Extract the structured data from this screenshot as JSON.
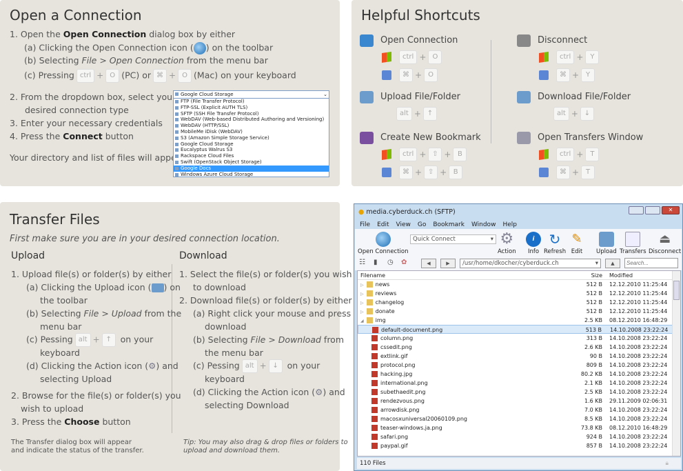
{
  "open_connection": {
    "title": "Open a Connection",
    "step1": "1.  Open the",
    "step1_bold": "Open Connection",
    "step1_rest": "dialog box by either",
    "step1a": "(a) Clicking the Open Connection icon (",
    "step1a_rest": ") on the toolbar",
    "step1b_pre": "(b) Selecting",
    "step1b_em": "File > Open Connection",
    "step1b_rest": "from the menu bar",
    "step1c_pre": "(c) Pressing",
    "key_ctrl": "ctrl",
    "key_o": "O",
    "pc": "(PC) or",
    "key_cmd": "⌘",
    "mac": "(Mac) on your keyboard",
    "plus": "+",
    "step2a": "2.  From the dropdown box, select your",
    "step2b": "desired connection type",
    "step3": "3.  Enter your necessary credentials",
    "step4": "4.  Press the",
    "step4_bold": "Connect",
    "step4_rest": "button",
    "footer": "Your directory and list of files will appear.",
    "dropdown": {
      "selected": "Google Cloud Storage",
      "highlighted": "Google Docs",
      "options": [
        "FTP (File Transfer Protocol)",
        "FTP-SSL (Explicit AUTH TLS)",
        "SFTP (SSH File Transfer Protocol)",
        "WebDAV (Web-based Distributed Authoring and Versioning)",
        "WebDAV (HTTP/SSL)",
        "MobileMe iDisk (WebDAV)",
        "S3 (Amazon Simple Storage Service)",
        "Google Cloud Storage",
        "Eucalyptus Walrus S3",
        "Rackspace Cloud Files",
        "Swift (OpenStack Object Storage)",
        "Google Docs",
        "Windows Azure Cloud Storage"
      ]
    }
  },
  "shortcuts": {
    "title": "Helpful Shortcuts",
    "plus": "+",
    "items": [
      {
        "label": "Open Connection",
        "win": [
          "ctrl",
          "O"
        ],
        "mac": [
          "⌘",
          "O"
        ]
      },
      {
        "label": "Upload File/Folder",
        "all": [
          "alt",
          "↑"
        ]
      },
      {
        "label": "Create New Bookmark",
        "win": [
          "ctrl",
          "⇧",
          "B"
        ],
        "mac": [
          "⌘",
          "⇧",
          "B"
        ]
      },
      {
        "label": "Disconnect",
        "win": [
          "ctrl",
          "Y"
        ],
        "mac": [
          "⌘",
          "Y"
        ]
      },
      {
        "label": "Download File/Folder",
        "all": [
          "alt",
          "↓"
        ]
      },
      {
        "label": "Open Transfers Window",
        "win": [
          "ctrl",
          "T"
        ],
        "mac": [
          "⌘",
          "T"
        ]
      }
    ]
  },
  "transfer": {
    "title": "Transfer Files",
    "subtitle": "First make sure you are in your desired connection location.",
    "upload": {
      "heading": "Upload",
      "l1": "1.  Upload file(s) or folder(s) by either",
      "l2": "(a) Clicking the Upload icon (",
      "l2b": ") on",
      "l3": "the toolbar",
      "l4": "(b) Selecting",
      "l4em": "File > Upload",
      "l4b": "from the",
      "l5": "menu bar",
      "l6": "(c) Pessing",
      "k1": "alt",
      "k2": "↑",
      "l6b": "on your",
      "l7": "keyboard",
      "l8": "(d) Clicking the Action icon (",
      "l8b": ") and",
      "l9": "selecting Upload",
      "l10": "2.  Browse for the file(s) or folder(s) you",
      "l11": "wish to upload",
      "l12": "3.  Press the",
      "l12b": "Choose",
      "l12c": "button",
      "f1": "The Transfer dialog box will appear",
      "f2": "and indicate the status of the transfer."
    },
    "download": {
      "heading": "Download",
      "l1": "1.  Select the file(s) or folder(s) you wish",
      "l2": "to download",
      "l3": "2.  Download file(s) or folder(s) by either",
      "l4": "(a) Right click your mouse and press",
      "l5": "download",
      "l6": "(b) Selecting",
      "l6em": "File > Download",
      "l6b": "from",
      "l7": "the menu bar",
      "l8": "(c) Pessing",
      "k1": "alt",
      "k2": "↓",
      "l8b": "on your",
      "l9": "keyboard",
      "l10": "(d) Clicking the Action icon (",
      "l10b": ") and",
      "l11": "selecting Download",
      "tip1": "Tip: You may also drag & drop files or folders to",
      "tip2": "upload and download them."
    }
  },
  "window": {
    "title": "media.cyberduck.ch (SFTP)",
    "menu": [
      "File",
      "Edit",
      "View",
      "Go",
      "Bookmark",
      "Window",
      "Help"
    ],
    "toolbar": {
      "open": "Open Connection",
      "quick": "Quick Connect",
      "action": "Action",
      "info": "Info",
      "refresh": "Refresh",
      "edit": "Edit",
      "upload": "Upload",
      "transfers": "Transfers",
      "disconnect": "Disconnect"
    },
    "path": "/usr/home/dkocher/cyberduck.ch",
    "search_placeholder": "Search...",
    "columns": [
      "Filename",
      "Size",
      "Modified"
    ],
    "files": [
      {
        "name": "news",
        "size": "512 B",
        "mod": "12.12.2010 11:25:44",
        "type": "folder"
      },
      {
        "name": "reviews",
        "size": "512 B",
        "mod": "12.12.2010 11:25:44",
        "type": "folder"
      },
      {
        "name": "changelog",
        "size": "512 B",
        "mod": "12.12.2010 11:25:44",
        "type": "folder"
      },
      {
        "name": "donate",
        "size": "512 B",
        "mod": "12.12.2010 11:25:44",
        "type": "folder"
      },
      {
        "name": "img",
        "size": "2.5 KB",
        "mod": "08.12.2010 16:48:29",
        "type": "folder-open"
      },
      {
        "name": "default-document.png",
        "size": "513 B",
        "mod": "14.10.2008 23:22:24",
        "type": "file",
        "selected": true
      },
      {
        "name": "column.png",
        "size": "313 B",
        "mod": "14.10.2008 23:22:24",
        "type": "file"
      },
      {
        "name": "cssedit.png",
        "size": "2.6 KB",
        "mod": "14.10.2008 23:22:24",
        "type": "file"
      },
      {
        "name": "extlink.gif",
        "size": "90 B",
        "mod": "14.10.2008 23:22:24",
        "type": "file"
      },
      {
        "name": "protocol.png",
        "size": "809 B",
        "mod": "14.10.2008 23:22:24",
        "type": "file"
      },
      {
        "name": "hacking.jpg",
        "size": "80.2 KB",
        "mod": "14.10.2008 23:22:24",
        "type": "file"
      },
      {
        "name": "international.png",
        "size": "2.1 KB",
        "mod": "14.10.2008 23:22:24",
        "type": "file"
      },
      {
        "name": "subethaedit.png",
        "size": "2.5 KB",
        "mod": "14.10.2008 23:22:24",
        "type": "file"
      },
      {
        "name": "rendezvous.png",
        "size": "1.6 KB",
        "mod": "29.11.2009 02:06:31",
        "type": "file"
      },
      {
        "name": "arrowdisk.png",
        "size": "7.0 KB",
        "mod": "14.10.2008 23:22:24",
        "type": "file"
      },
      {
        "name": "macosxuniversal20060109.png",
        "size": "8.5 KB",
        "mod": "14.10.2008 23:22:24",
        "type": "file"
      },
      {
        "name": "teaser-windows.ja.png",
        "size": "73.8 KB",
        "mod": "08.12.2010 16:48:29",
        "type": "file"
      },
      {
        "name": "safari.png",
        "size": "924 B",
        "mod": "14.10.2008 23:22:24",
        "type": "file"
      },
      {
        "name": "paypal.gif",
        "size": "857 B",
        "mod": "14.10.2008 23:22:24",
        "type": "file"
      }
    ],
    "status": "110 Files"
  }
}
